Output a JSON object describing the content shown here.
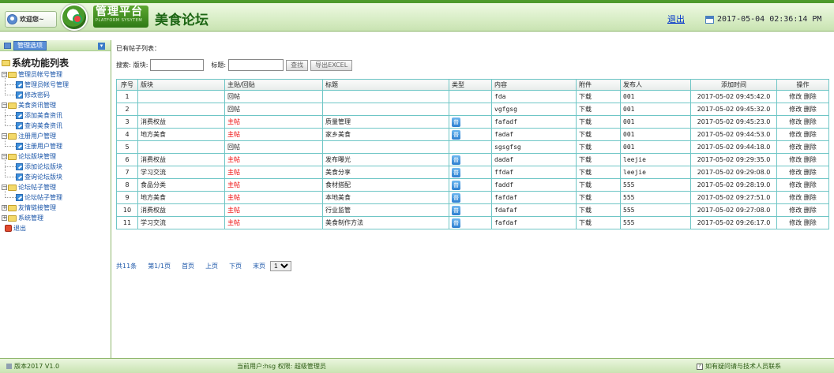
{
  "header": {
    "welcome": "欢迎您~",
    "logo_main": "管理平台",
    "logo_sub": "PLATFORM SYSYTEM",
    "site_title": "美食论坛",
    "logout": "退出",
    "datetime": "2017-05-04 02:36:14 PM"
  },
  "sidebar": {
    "header_label": "管理选项",
    "root": "系统功能列表",
    "items": [
      {
        "label": "管理员帐号管理",
        "kind": "group",
        "expanded": true
      },
      {
        "label": "管理员帐号管理",
        "kind": "leaf"
      },
      {
        "label": "修改密码",
        "kind": "leaf"
      },
      {
        "label": "美食资讯管理",
        "kind": "group",
        "expanded": true
      },
      {
        "label": "添加美食资讯",
        "kind": "leaf"
      },
      {
        "label": "查询美食资讯",
        "kind": "leaf"
      },
      {
        "label": "注册用户管理",
        "kind": "group",
        "expanded": true
      },
      {
        "label": "注册用户管理",
        "kind": "leaf"
      },
      {
        "label": "论坛版块管理",
        "kind": "group",
        "expanded": true
      },
      {
        "label": "添加论坛版块",
        "kind": "leaf"
      },
      {
        "label": "查询论坛版块",
        "kind": "leaf"
      },
      {
        "label": "论坛帖子管理",
        "kind": "group",
        "expanded": true
      },
      {
        "label": "论坛帖子管理",
        "kind": "leaf"
      },
      {
        "label": "友情链接管理",
        "kind": "group",
        "expanded": false
      },
      {
        "label": "系统管理",
        "kind": "group",
        "expanded": false
      },
      {
        "label": "退出",
        "kind": "exit"
      }
    ]
  },
  "main": {
    "list_title": "已有帖子列表：",
    "search_label": "搜索:",
    "board_label": "版块:",
    "board_value": "",
    "title_label": "标题:",
    "title_value": "",
    "search_button": "查找",
    "export_button": "导出EXCEL",
    "columns": [
      "序号",
      "版块",
      "主贴/回贴",
      "标题",
      "类型",
      "内容",
      "附件",
      "发布人",
      "添加时间",
      "操作"
    ],
    "rows": [
      {
        "no": "1",
        "board": "",
        "kind": "回帖",
        "title": "",
        "type": "",
        "content": "fda",
        "attach": "下载",
        "author": "001",
        "time": "2017-05-02 09:45:42.0",
        "edit": "修改",
        "del": "删除"
      },
      {
        "no": "2",
        "board": "",
        "kind": "回帖",
        "title": "",
        "type": "",
        "content": "vgfgsg",
        "attach": "下载",
        "author": "001",
        "time": "2017-05-02 09:45:32.0",
        "edit": "修改",
        "del": "删除"
      },
      {
        "no": "3",
        "board": "消费权益",
        "kind": "主帖",
        "title": "质量管理",
        "type": "普",
        "content": "fafadf",
        "attach": "下载",
        "author": "001",
        "time": "2017-05-02 09:45:23.0",
        "edit": "修改",
        "del": "删除"
      },
      {
        "no": "4",
        "board": "地方美食",
        "kind": "主帖",
        "title": "家乡美食",
        "type": "普",
        "content": "fadaf",
        "attach": "下载",
        "author": "001",
        "time": "2017-05-02 09:44:53.0",
        "edit": "修改",
        "del": "删除"
      },
      {
        "no": "5",
        "board": "",
        "kind": "回帖",
        "title": "",
        "type": "",
        "content": "sgsgfsg",
        "attach": "下载",
        "author": "001",
        "time": "2017-05-02 09:44:18.0",
        "edit": "修改",
        "del": "删除"
      },
      {
        "no": "6",
        "board": "消费权益",
        "kind": "主帖",
        "title": "发布曝光",
        "type": "普",
        "content": "dadaf",
        "attach": "下载",
        "author": "leejie",
        "time": "2017-05-02 09:29:35.0",
        "edit": "修改",
        "del": "删除"
      },
      {
        "no": "7",
        "board": "学习交流",
        "kind": "主帖",
        "title": "美食分享",
        "type": "普",
        "content": "ffdaf",
        "attach": "下载",
        "author": "leejie",
        "time": "2017-05-02 09:29:08.0",
        "edit": "修改",
        "del": "删除"
      },
      {
        "no": "8",
        "board": "食品分类",
        "kind": "主帖",
        "title": "食材搭配",
        "type": "普",
        "content": "faddf",
        "attach": "下载",
        "author": "555",
        "time": "2017-05-02 09:28:19.0",
        "edit": "修改",
        "del": "删除"
      },
      {
        "no": "9",
        "board": "地方美食",
        "kind": "主帖",
        "title": "本地美食",
        "type": "普",
        "content": "fafdaf",
        "attach": "下载",
        "author": "555",
        "time": "2017-05-02 09:27:51.0",
        "edit": "修改",
        "del": "删除"
      },
      {
        "no": "10",
        "board": "消费权益",
        "kind": "主帖",
        "title": "行业监管",
        "type": "普",
        "content": "fdafaf",
        "attach": "下载",
        "author": "555",
        "time": "2017-05-02 09:27:08.0",
        "edit": "修改",
        "del": "删除"
      },
      {
        "no": "11",
        "board": "学习交流",
        "kind": "主帖",
        "title": "美食制作方法",
        "type": "普",
        "content": "fafdaf",
        "attach": "下载",
        "author": "555",
        "time": "2017-05-02 09:26:17.0",
        "edit": "修改",
        "del": "删除"
      }
    ],
    "pager": {
      "total": "共11条",
      "page": "第1/1页",
      "first": "首页",
      "prev": "上页",
      "next": "下页",
      "last": "末页",
      "selected": "1"
    }
  },
  "footer": {
    "version": "版本2017 V1.0",
    "current_user_label": "当前用户:",
    "current_user": "hsg",
    "role_label": "权限:",
    "role": "超级管理员",
    "help": "如有疑问请与技术人员联系"
  },
  "colors": {
    "accent_green": "#4e9a2c",
    "grid_border": "#6fc6c6",
    "main_post_red": "#ee0000",
    "link_blue": "#1a55a8"
  }
}
